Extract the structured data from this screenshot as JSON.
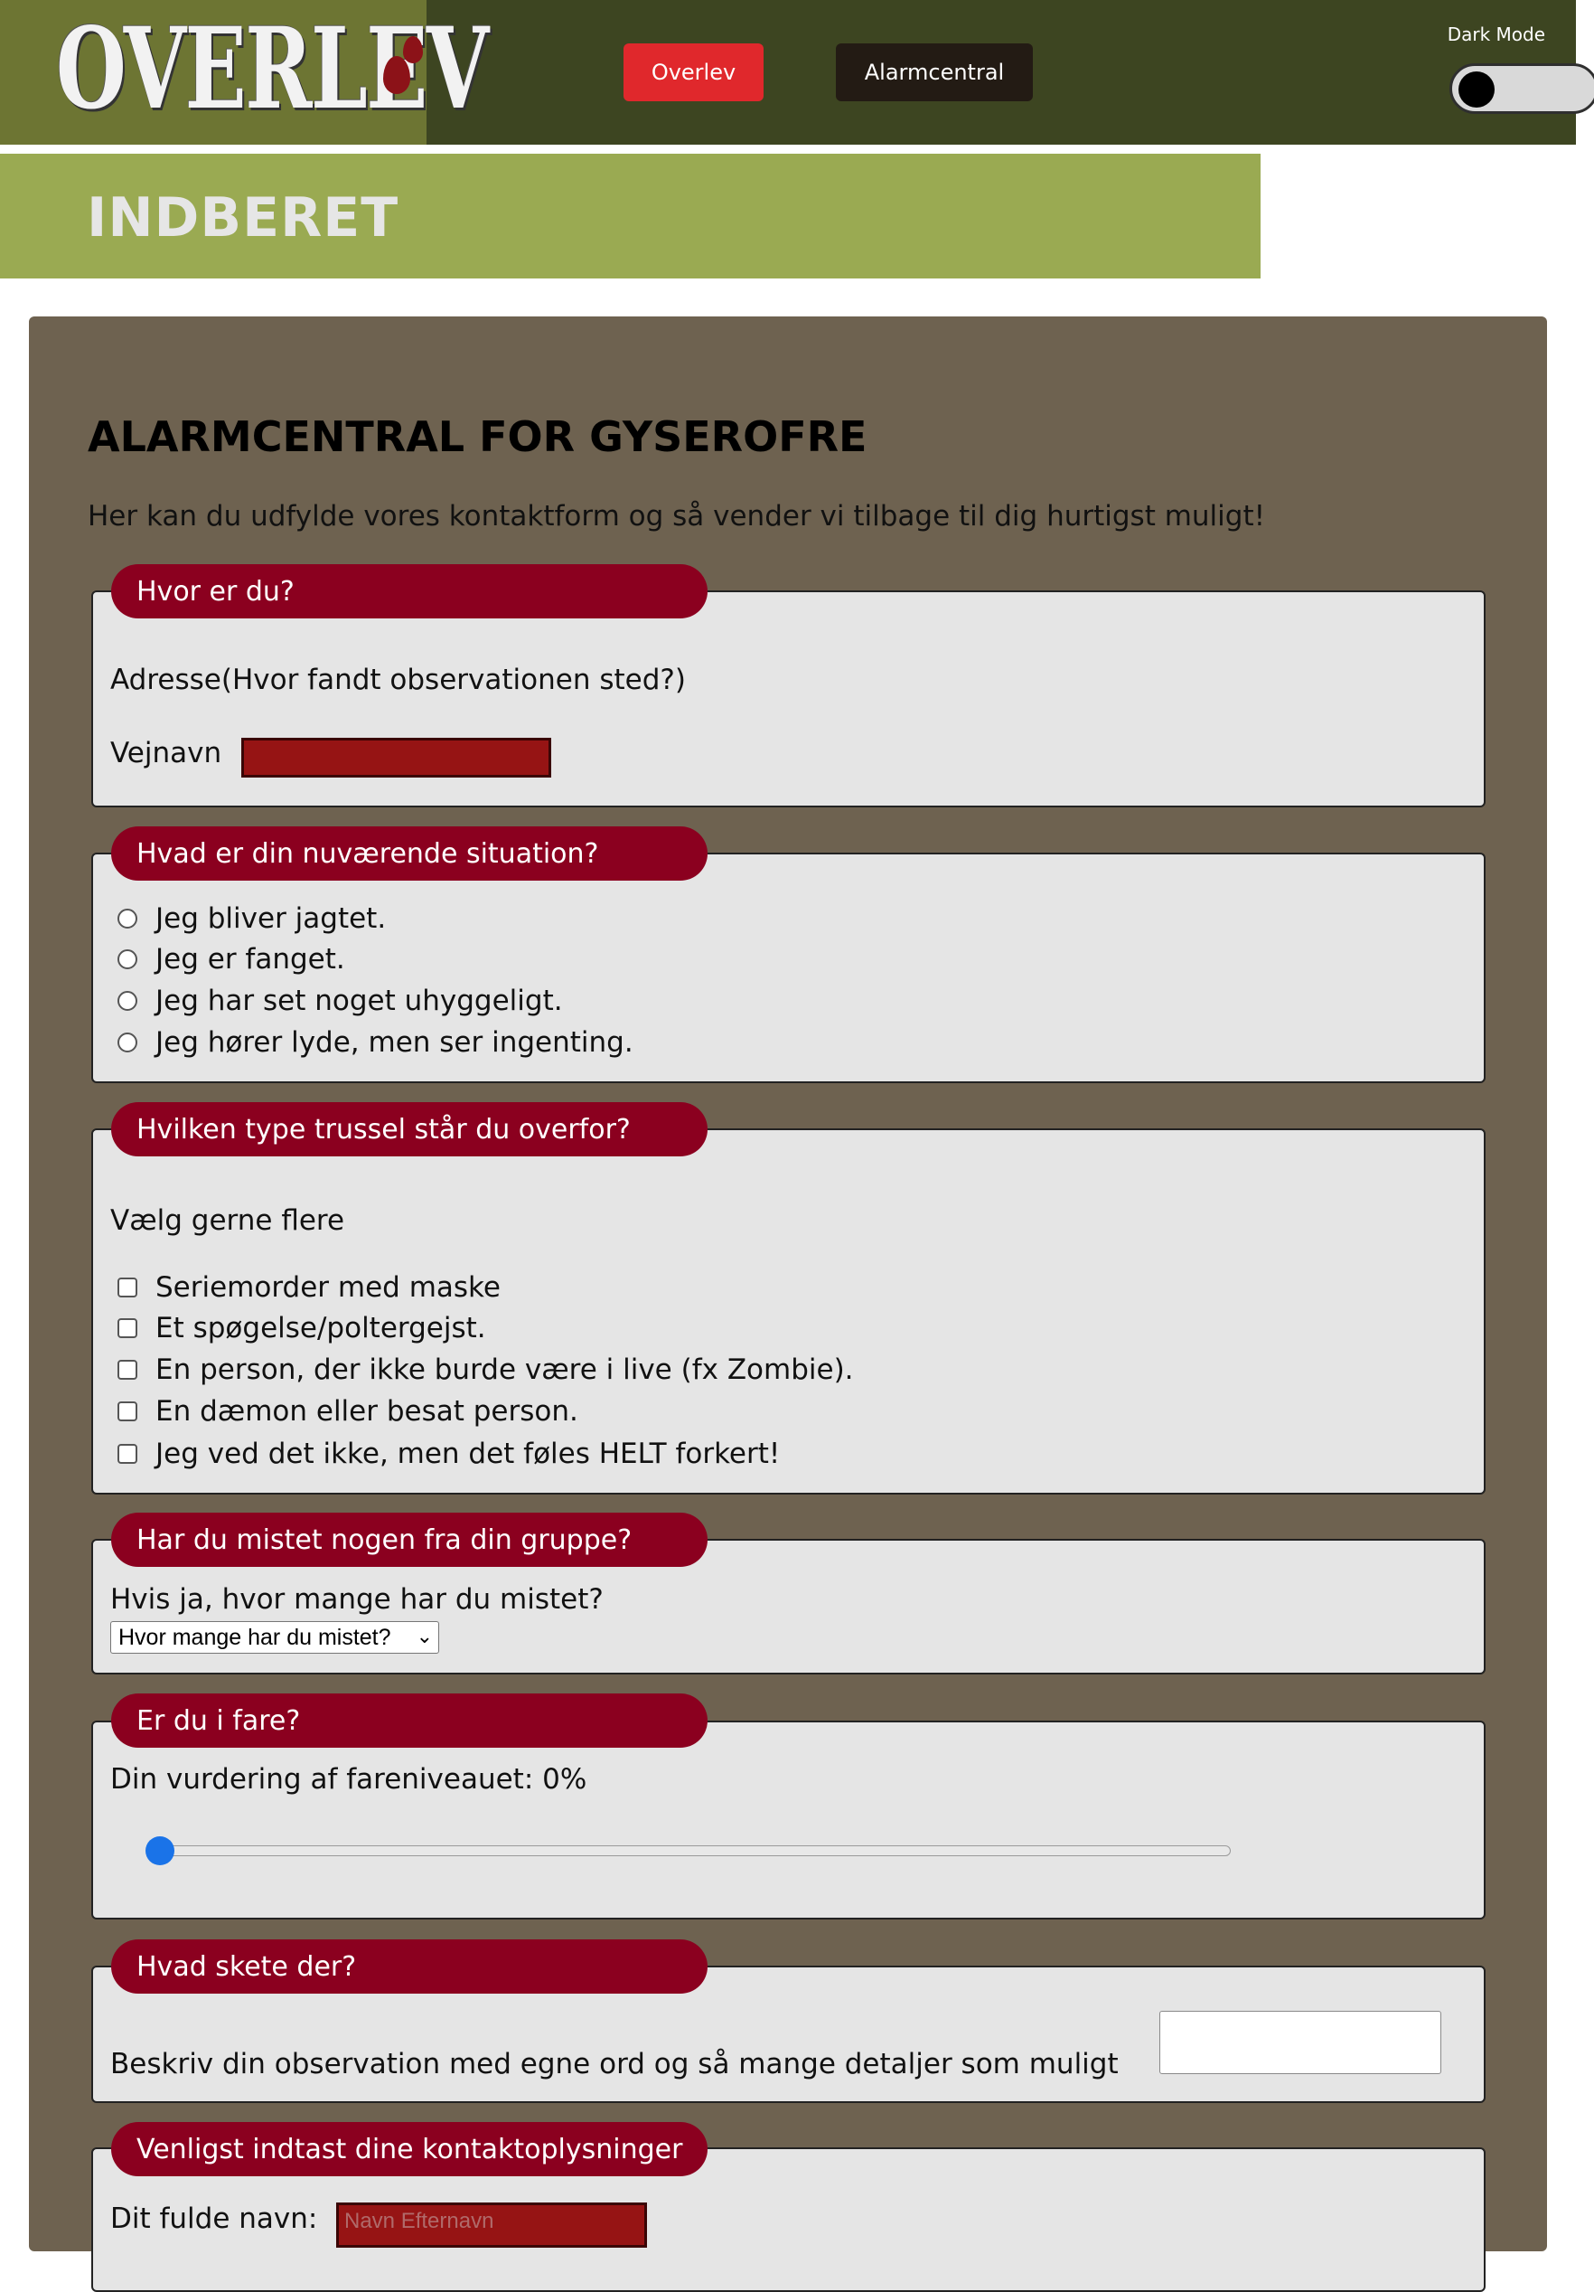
{
  "header": {
    "logo_text": "OVERLEV",
    "nav": [
      "Overlev",
      "Alarmcentral"
    ],
    "dark_mode_label": "Dark Mode",
    "dark_mode_on": false
  },
  "banner": {
    "title": "INDBERET"
  },
  "form": {
    "title": "ALARMCENTRAL FOR GYSEROFRE",
    "intro": "Her kan du udfylde vores kontaktform og så vender vi tilbage til dig hurtigst muligt!",
    "location": {
      "legend": "Hvor er du?",
      "label": "Adresse(Hvor fandt observationen sted?)",
      "street_label": "Vejnavn",
      "street_value": ""
    },
    "situation": {
      "legend": "Hvad er din nuværende situation?",
      "options": [
        "Jeg bliver jagtet.",
        "Jeg er fanget.",
        "Jeg har set noget uhyggeligt.",
        "Jeg hører lyde, men ser ingenting."
      ]
    },
    "threat": {
      "legend": "Hvilken type trussel står du overfor?",
      "hint": "Vælg gerne flere",
      "options": [
        "Seriemorder med maske",
        "Et spøgelse/poltergejst.",
        "En person, der ikke burde være i live (fx Zombie).",
        "En dæmon eller besat person.",
        "Jeg ved det ikke, men det føles HELT forkert!"
      ]
    },
    "lost": {
      "legend": "Har du mistet nogen fra din gruppe?",
      "question": "Hvis ja, hvor mange har du mistet?",
      "select_value": "Hvor mange har du mistet?"
    },
    "danger": {
      "legend": "Er du i fare?",
      "label": "Din vurdering af fareniveauet: 0%",
      "level": 0
    },
    "what": {
      "legend": "Hvad skete der?",
      "label": "Beskriv din observation med egne ord og så mange detaljer som muligt"
    },
    "contact": {
      "legend": "Venligst indtast dine kontaktoplysninger",
      "name_label": "Dit fulde navn:",
      "name_placeholder": "Navn Efternavn"
    }
  }
}
